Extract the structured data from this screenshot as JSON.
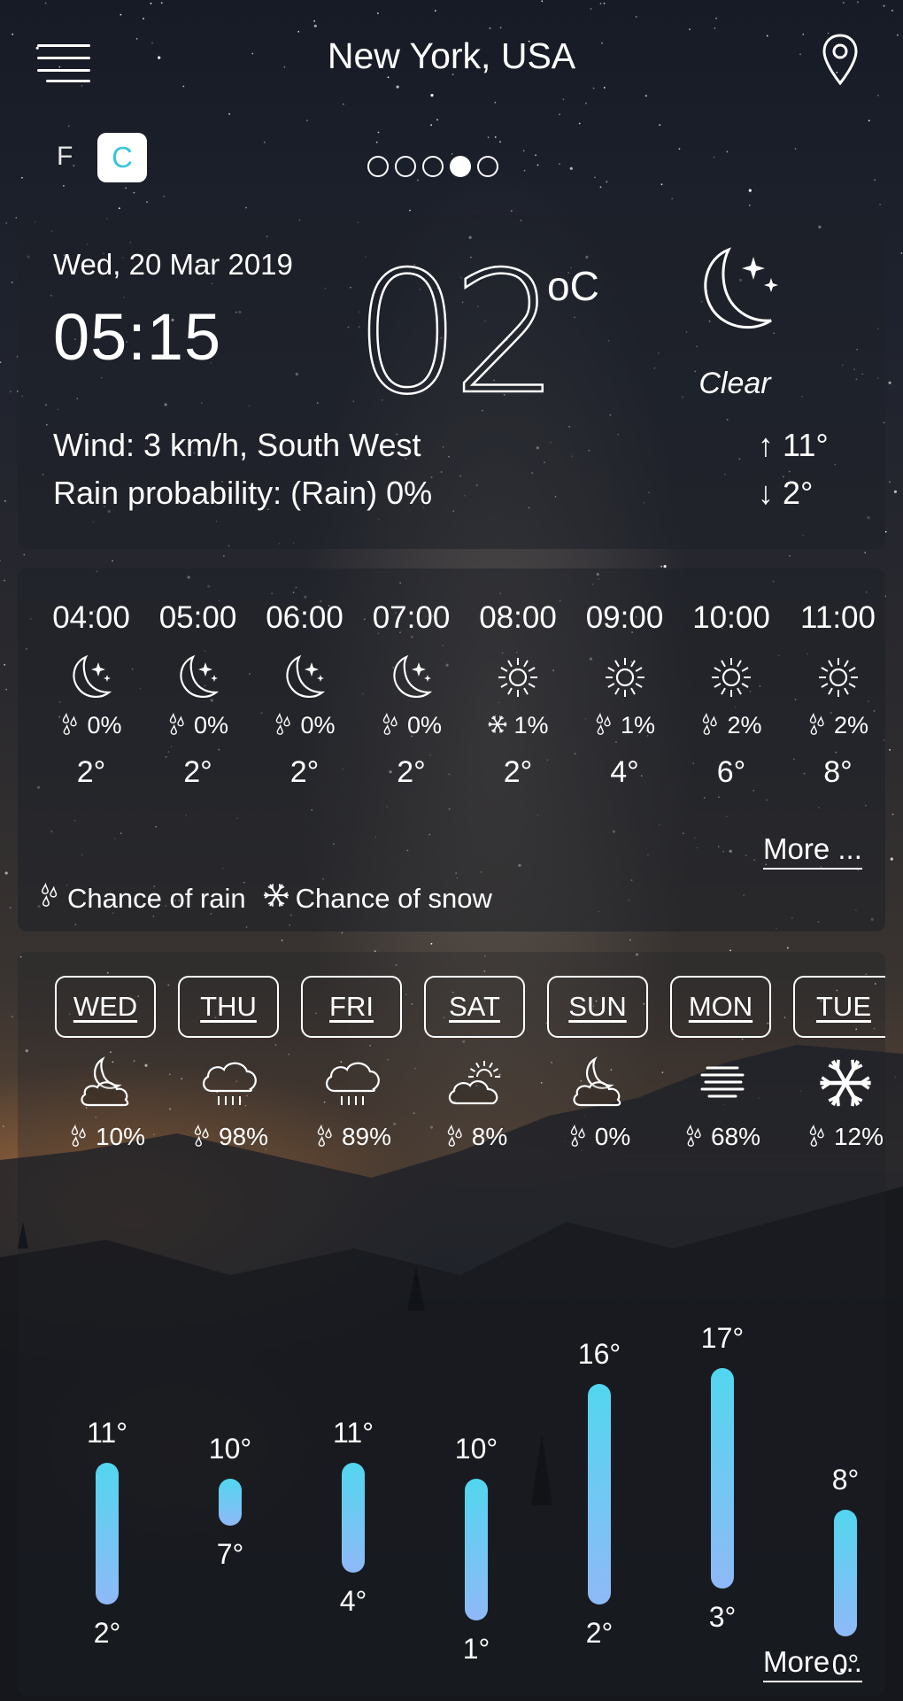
{
  "header": {
    "title": "New York, USA",
    "menu_icon": "menu-icon",
    "location_icon": "location-pin-icon"
  },
  "units": {
    "fahrenheit": "F",
    "celsius": "C",
    "selected": "C"
  },
  "pager": {
    "pages": 5,
    "active_index": 3
  },
  "current": {
    "date": "Wed, 20 Mar 2019",
    "time": "05:15",
    "temperature": "02",
    "temperature_unit": "oC",
    "condition": "Clear",
    "condition_icon": "moon-stars-icon",
    "wind": "Wind: 3 km/h, South West",
    "rain_probability": "Rain probability: (Rain) 0%",
    "high": "↑ 11°",
    "low": "↓ 2°"
  },
  "hourly": [
    {
      "time": "04:00",
      "icon": "moon-icon",
      "precip_icon": "rain-drops-icon",
      "precip": "0%",
      "temp": "2°"
    },
    {
      "time": "05:00",
      "icon": "moon-icon",
      "precip_icon": "rain-drops-icon",
      "precip": "0%",
      "temp": "2°"
    },
    {
      "time": "06:00",
      "icon": "moon-icon",
      "precip_icon": "rain-drops-icon",
      "precip": "0%",
      "temp": "2°"
    },
    {
      "time": "07:00",
      "icon": "moon-icon",
      "precip_icon": "rain-drops-icon",
      "precip": "0%",
      "temp": "2°"
    },
    {
      "time": "08:00",
      "icon": "sun-icon",
      "precip_icon": "snowflake-icon",
      "precip": "1%",
      "temp": "2°"
    },
    {
      "time": "09:00",
      "icon": "sun-icon",
      "precip_icon": "rain-drops-icon",
      "precip": "1%",
      "temp": "4°"
    },
    {
      "time": "10:00",
      "icon": "sun-icon",
      "precip_icon": "rain-drops-icon",
      "precip": "2%",
      "temp": "6°"
    },
    {
      "time": "11:00",
      "icon": "sun-icon",
      "precip_icon": "rain-drops-icon",
      "precip": "2%",
      "temp": "8°"
    }
  ],
  "hourly_more": "More ...",
  "legend": {
    "rain": "Chance of rain",
    "snow": "Chance of snow"
  },
  "daily": [
    {
      "day": "WED",
      "icon": "cloud-moon-icon",
      "precip": "10%",
      "high": 11,
      "low": 2,
      "high_label": "11°",
      "low_label": "2°"
    },
    {
      "day": "THU",
      "icon": "cloud-rain-icon",
      "precip": "98%",
      "high": 10,
      "low": 7,
      "high_label": "10°",
      "low_label": "7°"
    },
    {
      "day": "FRI",
      "icon": "cloud-rain-icon",
      "precip": "89%",
      "high": 11,
      "low": 4,
      "high_label": "11°",
      "low_label": "4°"
    },
    {
      "day": "SAT",
      "icon": "cloud-sun-icon",
      "precip": "8%",
      "high": 10,
      "low": 1,
      "high_label": "10°",
      "low_label": "1°"
    },
    {
      "day": "SUN",
      "icon": "cloud-moon-icon",
      "precip": "0%",
      "high": 16,
      "low": 2,
      "high_label": "16°",
      "low_label": "2°"
    },
    {
      "day": "MON",
      "icon": "fog-icon",
      "precip": "68%",
      "high": 17,
      "low": 3,
      "high_label": "17°",
      "low_label": "3°"
    },
    {
      "day": "TUE",
      "icon": "snowflake-icon",
      "precip": "12%",
      "high": 8,
      "low": 0,
      "high_label": "8°",
      "low_label": "0°"
    }
  ],
  "daily_more": "More ..."
}
